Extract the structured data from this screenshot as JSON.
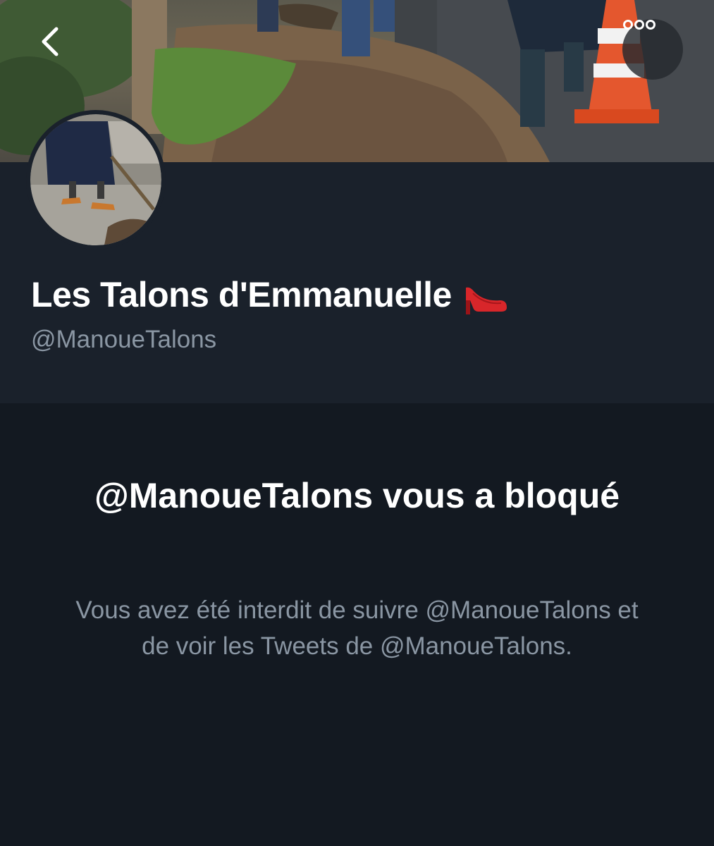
{
  "profile": {
    "display_name": "Les Talons d'Emmanuelle",
    "name_emoji": "high-heel-shoe",
    "handle": "@ManoueTalons"
  },
  "navigation": {
    "back_icon": "chevron-left-icon",
    "more_icon": "more-options-icon"
  },
  "blocked_notice": {
    "title": "@ManoueTalons vous a bloqué",
    "description": "Vous avez été interdit de suivre @ManoueTalons et de voir les Tweets de @ManoueTalons."
  },
  "colors": {
    "background": "#131921",
    "header_panel": "#1a212b",
    "secondary_text": "#8a96a3",
    "primary_text": "#ffffff"
  }
}
